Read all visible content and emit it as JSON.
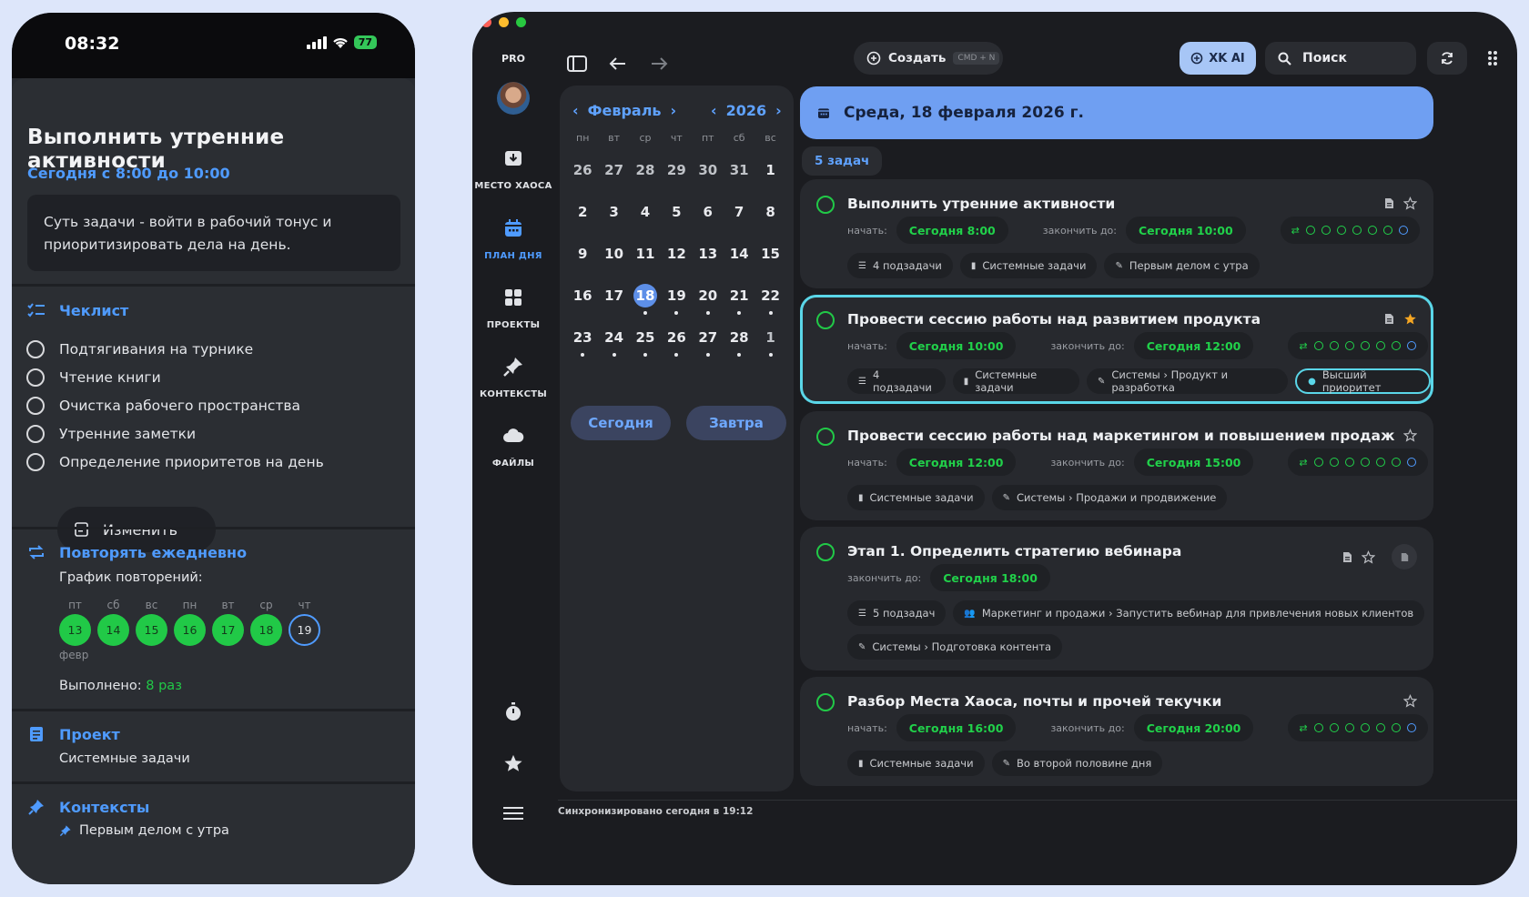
{
  "phone": {
    "status_time": "08:32",
    "battery": "77",
    "task_title": "Выполнить утренние активности",
    "time_range": "Сегодня с 8:00 до 10:00",
    "description": "Суть задачи - войти в рабочий тонус и приоритизировать дела на день.",
    "checklist_title": "Чеклист",
    "checklist": [
      "Подтягивания на турнике",
      "Чтение книги",
      "Очистка рабочего пространства",
      "Утренние заметки",
      "Определение приоритетов на день"
    ],
    "edit_label": "Изменить",
    "repeat_title": "Повторять ежедневно",
    "schedule_label": "График повторений:",
    "repeat_days": [
      {
        "wd": "пт",
        "d": "13"
      },
      {
        "wd": "сб",
        "d": "14"
      },
      {
        "wd": "вс",
        "d": "15"
      },
      {
        "wd": "пн",
        "d": "16"
      },
      {
        "wd": "вт",
        "d": "17"
      },
      {
        "wd": "ср",
        "d": "18"
      },
      {
        "wd": "чт",
        "d": "19"
      }
    ],
    "month_short": "февр",
    "done_label": "Выполнено:",
    "done_value": "8 раз",
    "project_title": "Проект",
    "project_value": "Системные задачи",
    "contexts_title": "Контексты",
    "contexts_value": "Первым делом с утра"
  },
  "sidebar": {
    "pro": "PRO",
    "items": [
      {
        "label": "МЕСТО ХАОСА",
        "icon": "inbox-icon"
      },
      {
        "label": "ПЛАН ДНЯ",
        "icon": "calendar-icon"
      },
      {
        "label": "ПРОЕКТЫ",
        "icon": "grid-icon"
      },
      {
        "label": "КОНТЕКСТЫ",
        "icon": "pin-icon"
      },
      {
        "label": "ФАЙЛЫ",
        "icon": "cloud-icon"
      }
    ]
  },
  "toolbar": {
    "create_label": "Создать",
    "create_kbd": "CMD + N",
    "ai_label": "XK AI",
    "search_label": "Поиск"
  },
  "calendar": {
    "month": "Февраль",
    "year": "2026",
    "weekdays": [
      "пн",
      "вт",
      "ср",
      "чт",
      "пт",
      "сб",
      "вс"
    ],
    "weeks": [
      [
        "26",
        "27",
        "28",
        "29",
        "30",
        "31",
        "1"
      ],
      [
        "2",
        "3",
        "4",
        "5",
        "6",
        "7",
        "8"
      ],
      [
        "9",
        "10",
        "11",
        "12",
        "13",
        "14",
        "15"
      ],
      [
        "16",
        "17",
        "18",
        "19",
        "20",
        "21",
        "22"
      ],
      [
        "23",
        "24",
        "25",
        "26",
        "27",
        "28",
        "1"
      ]
    ],
    "today_label": "Сегодня",
    "tomorrow_label": "Завтра"
  },
  "main": {
    "date_title": "Среда, 18 февраля 2026 г.",
    "task_count": "5 задач",
    "start_label": "начать:",
    "end_label": "закончить до:",
    "tasks": [
      {
        "title": "Выполнить утренние активности",
        "start": "Сегодня 8:00",
        "end": "Сегодня 10:00",
        "tags": [
          "4 подзадачи",
          "Системные задачи",
          "Первым делом с утра"
        ]
      },
      {
        "title": "Провести сессию работы над развитием продукта",
        "start": "Сегодня 10:00",
        "end": "Сегодня 12:00",
        "tags": [
          "4 подзадачи",
          "Системные задачи",
          "Системы › Продукт и разработка",
          "Высший приоритет"
        ]
      },
      {
        "title": "Провести сессию работы над маркетингом и повышением продаж",
        "start": "Сегодня 12:00",
        "end": "Сегодня 15:00",
        "tags": [
          "Системные задачи",
          "Системы › Продажи и продвижение"
        ]
      },
      {
        "title": "Этап 1. Определить стратегию вебинара",
        "end": "Сегодня 18:00",
        "tags": [
          "5 подзадач",
          "Маркетинг и продажи › Запустить вебинар для привлечения новых клиентов",
          "Системы › Подготовка контента"
        ]
      },
      {
        "title": "Разбор Места Хаоса, почты и прочей текучки",
        "start": "Сегодня 16:00",
        "end": "Сегодня 20:00",
        "tags": [
          "Системные задачи",
          "Во второй половине дня"
        ]
      }
    ],
    "sync_text": "Синхронизировано сегодня в 19:12"
  },
  "colors": {
    "accent": "#4f9bff",
    "green": "#21c947",
    "banner": "#6f9ff2",
    "highlight": "#5ad6e8"
  }
}
